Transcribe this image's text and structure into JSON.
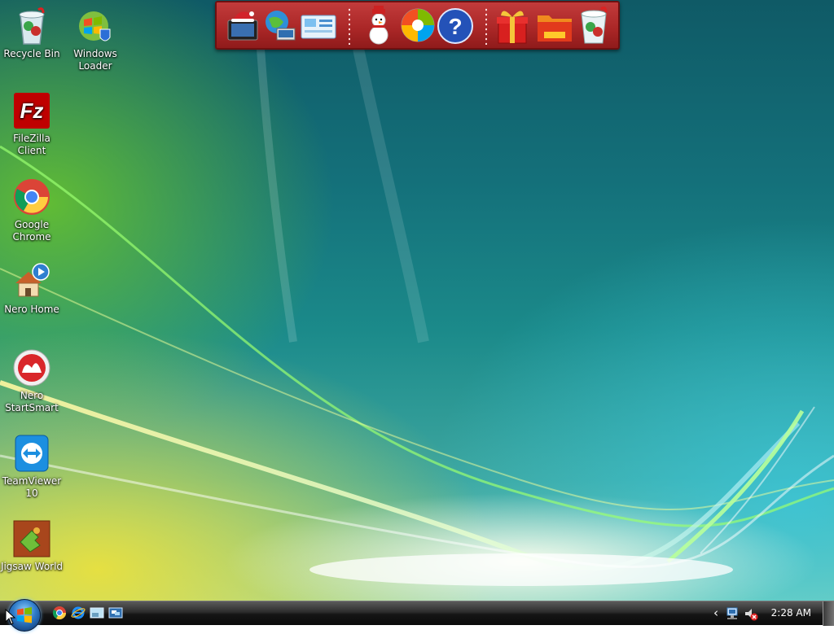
{
  "desktop": {
    "icons": [
      {
        "label": "Recycle Bin",
        "icon": "recycle-bin-icon"
      },
      {
        "label": "Windows Loader",
        "icon": "windows-loader-icon"
      },
      {
        "label": "FileZilla Client",
        "icon": "filezilla-icon",
        "glyph": "Fz"
      },
      {
        "label": "Google Chrome",
        "icon": "chrome-icon"
      },
      {
        "label": "Nero Home",
        "icon": "nero-home-icon"
      },
      {
        "label": "Nero StartSmart",
        "icon": "nero-startsmart-icon"
      },
      {
        "label": "TeamViewer 10",
        "icon": "teamviewer-icon"
      },
      {
        "label": "Jigsaw World",
        "icon": "jigsaw-world-icon"
      }
    ]
  },
  "dock": {
    "items": [
      {
        "name": "santa-computer-icon"
      },
      {
        "name": "globe-network-icon"
      },
      {
        "name": "control-panel-icon"
      },
      {
        "name": "snowman-icon"
      },
      {
        "name": "windows-shield-icon"
      },
      {
        "name": "help-icon",
        "glyph": "?"
      },
      {
        "name": "gift-icon"
      },
      {
        "name": "folder-icon"
      },
      {
        "name": "recycle-bin-icon"
      }
    ]
  },
  "taskbar": {
    "quick_launch": [
      {
        "name": "chrome-quicklaunch-icon"
      },
      {
        "name": "internet-explorer-icon"
      },
      {
        "name": "show-desktop-quicklaunch-icon"
      },
      {
        "name": "switch-windows-icon"
      }
    ],
    "tray": {
      "arrow": "‹",
      "icons": [
        "network-icon",
        "volume-muted-icon"
      ],
      "clock": "2:28 AM"
    }
  },
  "colors": {
    "dock_red": "#a92626",
    "taskbar": "#1a1a1a"
  }
}
